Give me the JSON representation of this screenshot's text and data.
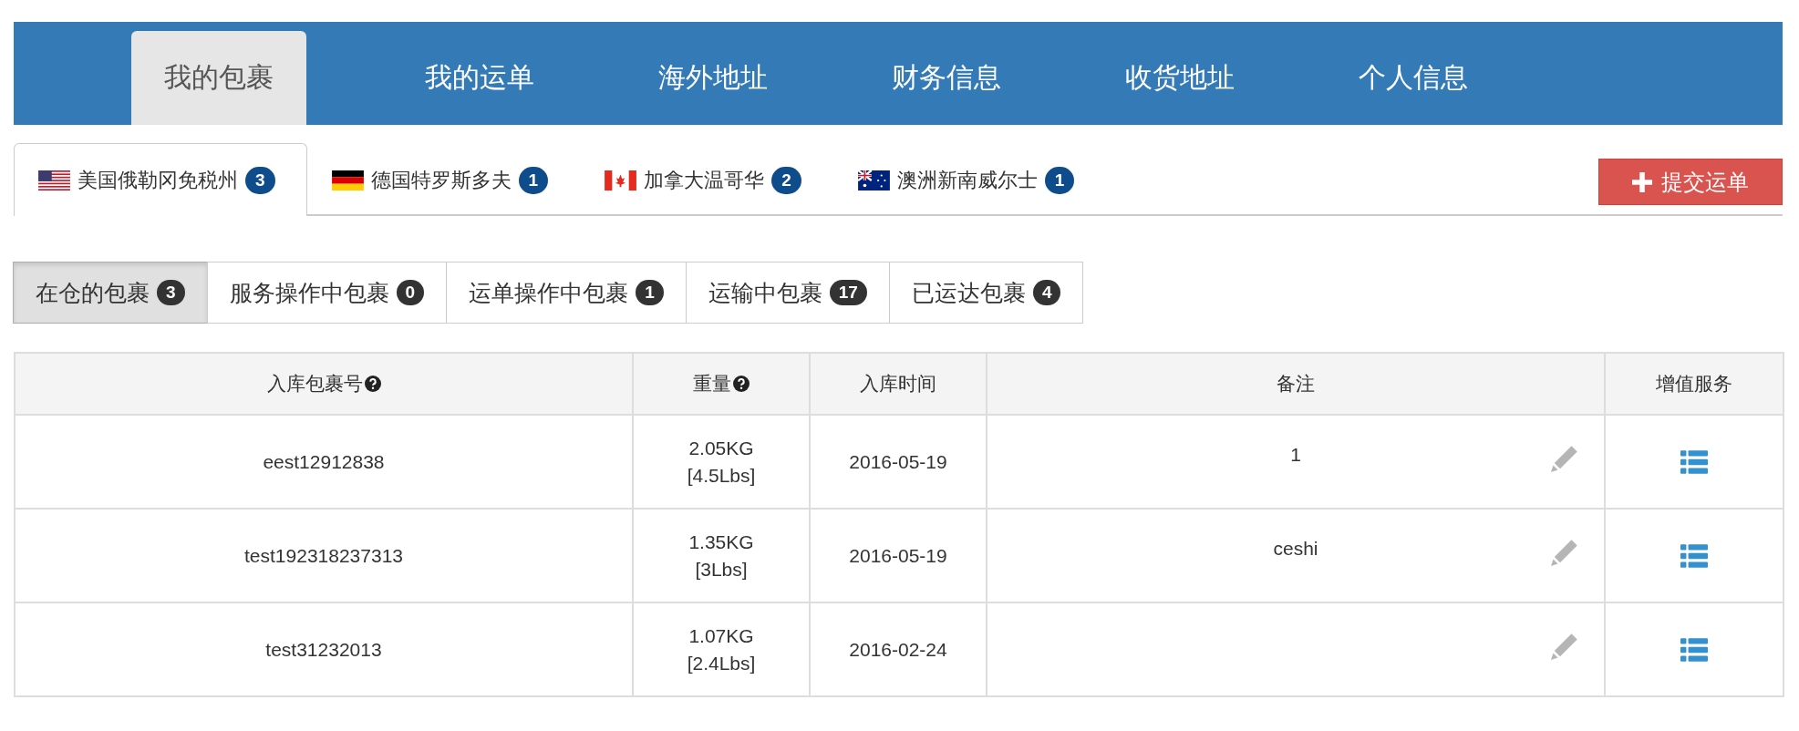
{
  "nav": {
    "items": [
      {
        "label": "我的包裹",
        "selected": true
      },
      {
        "label": "我的运单",
        "selected": false
      },
      {
        "label": "海外地址",
        "selected": false
      },
      {
        "label": "财务信息",
        "selected": false
      },
      {
        "label": "收货地址",
        "selected": false
      },
      {
        "label": "个人信息",
        "selected": false
      }
    ]
  },
  "warehouse_tabs": [
    {
      "kind": "us",
      "label": "美国俄勒冈免税州",
      "count": "3",
      "selected": true
    },
    {
      "kind": "de",
      "label": "德国特罗斯多夫",
      "count": "1",
      "selected": false
    },
    {
      "kind": "ca",
      "label": "加拿大温哥华",
      "count": "2",
      "selected": false
    },
    {
      "kind": "au",
      "label": "澳洲新南威尔士",
      "count": "1",
      "selected": false
    }
  ],
  "submit_button": {
    "label": "提交运单"
  },
  "status_tabs": [
    {
      "label": "在仓的包裹",
      "count": "3",
      "selected": true
    },
    {
      "label": "服务操作中包裹",
      "count": "0",
      "selected": false
    },
    {
      "label": "运单操作中包裹",
      "count": "1",
      "selected": false
    },
    {
      "label": "运输中包裹",
      "count": "17",
      "selected": false
    },
    {
      "label": "已运达包裹",
      "count": "4",
      "selected": false
    }
  ],
  "table": {
    "columns": [
      {
        "label": "入库包裹号",
        "help": true
      },
      {
        "label": "重量",
        "help": true
      },
      {
        "label": "入库时间",
        "help": false
      },
      {
        "label": "备注",
        "help": false
      },
      {
        "label": "增值服务",
        "help": false
      }
    ],
    "rows": [
      {
        "id": "eest12912838",
        "weight": "2.05KG",
        "weight_lbs": "[4.5Lbs]",
        "date": "2016-05-19",
        "remark": "1"
      },
      {
        "id": "test192318237313",
        "weight": "1.35KG",
        "weight_lbs": "[3Lbs]",
        "date": "2016-05-19",
        "remark": "ceshi"
      },
      {
        "id": "test31232013",
        "weight": "1.07KG",
        "weight_lbs": "[2.4Lbs]",
        "date": "2016-02-24"
      }
    ]
  }
}
